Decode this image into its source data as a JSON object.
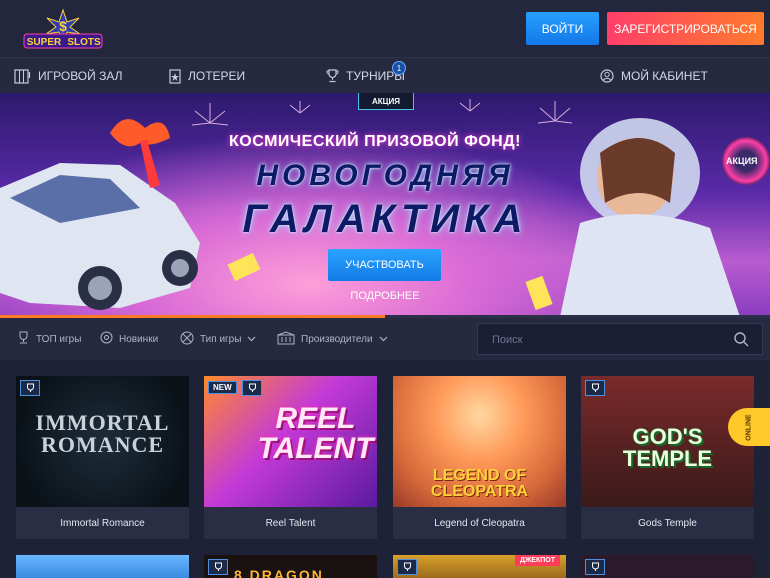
{
  "header": {
    "logo_text_top": "SUPER",
    "logo_text_bottom": "SLOTS",
    "logo_symbol": "$",
    "login_label": "ВОЙТИ",
    "register_label": "ЗАРЕГИСТРИРОВАТЬСЯ"
  },
  "nav": {
    "items": [
      {
        "label": "ИГРОВОЙ ЗАЛ",
        "icon": "slot-machine-icon"
      },
      {
        "label": "ЛОТЕРЕИ",
        "icon": "lottery-ticket-icon"
      },
      {
        "label": "ТУРНИРЫ",
        "icon": "trophy-icon",
        "badge": "1"
      },
      {
        "label": "МОЙ КАБИНЕТ",
        "icon": "user-icon"
      }
    ]
  },
  "banner": {
    "tag": "АКЦИЯ",
    "subtitle": "КОСМИЧЕСКИЙ ПРИЗОВОЙ ФОНД!",
    "title_line1": "НОВОГОДНЯЯ",
    "title_line2": "ГАЛАКТИКА",
    "cta_label": "УЧАСТВОВАТЬ",
    "more_label": "ПОДРОБНЕЕ",
    "side_promo_label": "АКЦИЯ",
    "progress": 0.5
  },
  "filters": {
    "items": [
      {
        "label": "ТОП игры",
        "icon": "top-games-icon"
      },
      {
        "label": "Новинки",
        "icon": "new-games-icon"
      },
      {
        "label": "Тип игры",
        "icon": "game-type-icon",
        "dropdown": true
      },
      {
        "label": "Производители",
        "icon": "providers-icon",
        "dropdown": true
      }
    ],
    "search_placeholder": "Поиск"
  },
  "games": [
    {
      "name": "Immortal Romance",
      "thumb_title": "IMMORTAL ROMANCE",
      "new": false
    },
    {
      "name": "Reel Talent",
      "thumb_title": "REEL TALENT",
      "new": true,
      "new_label": "NEW"
    },
    {
      "name": "Legend of Cleopatra",
      "thumb_title": "LEGEND OF CLEOPATRA",
      "new": false
    },
    {
      "name": "Gods Temple",
      "thumb_title": "GOD'S TEMPLE",
      "new": false
    }
  ],
  "second_row": {
    "jackpot_label": "ДЖЕКПОТ",
    "partial_title": "8 DRAGON"
  },
  "online_label": "ONLINE",
  "colors": {
    "bg": "#1e2236",
    "panel": "#262a40",
    "login": "#1f8cf5",
    "register_from": "#ff3f6a",
    "register_to": "#ff7b2c",
    "progress": "#ff7a22"
  }
}
